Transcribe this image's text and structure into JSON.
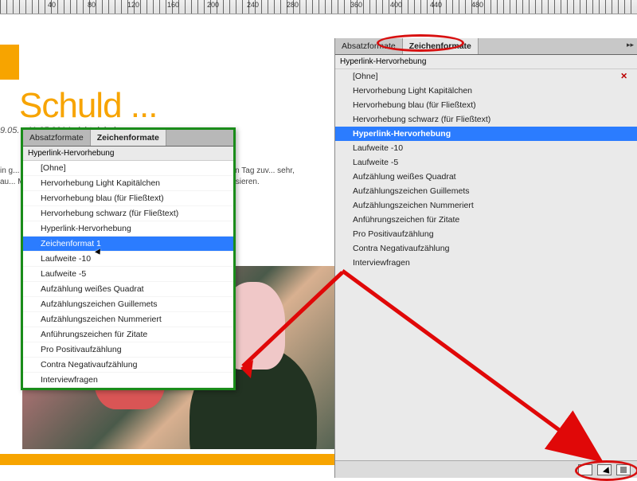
{
  "ruler": {
    "labels": [
      {
        "pos": 60,
        "text": "40"
      },
      {
        "pos": 110,
        "text": "80"
      },
      {
        "pos": 160,
        "text": "120"
      },
      {
        "pos": 210,
        "text": "160"
      },
      {
        "pos": 260,
        "text": "200"
      },
      {
        "pos": 310,
        "text": "240"
      },
      {
        "pos": 360,
        "text": "280"
      },
      {
        "pos": 440,
        "text": "360"
      },
      {
        "pos": 490,
        "text": "400"
      },
      {
        "pos": 540,
        "text": "440"
      },
      {
        "pos": 592,
        "text": "480"
      }
    ]
  },
  "document": {
    "title": "Schuld ...",
    "subtitle": "9.05. - 11.05.2014 nicht dabei war.",
    "body": "in g... n Be... ei. W... sehe... gest... on au... Mitglieder ersönlichen blieben: Ge- as Usertref- m nächsten  Tag zuv... sehr, d... tionster... hat, au... sieren."
  },
  "panels": {
    "tabs": {
      "absatz": "Absatzformate",
      "zeichen": "Zeichenformate"
    },
    "header": "Hyperlink-Hervorhebung",
    "none_label": "[Ohne]",
    "floating_items": [
      {
        "label": "[Ohne]"
      },
      {
        "label": "Hervorhebung Light Kapitälchen"
      },
      {
        "label": "Hervorhebung blau (für Fließtext)"
      },
      {
        "label": "Hervorhebung schwarz (für Fließtext)"
      },
      {
        "label": "Hyperlink-Hervorhebung"
      },
      {
        "label": "Zeichenformat 1",
        "selected": true
      },
      {
        "label": "Laufweite -10"
      },
      {
        "label": "Laufweite -5"
      },
      {
        "label": "Aufzählung weißes Quadrat"
      },
      {
        "label": "Aufzählungszeichen Guillemets"
      },
      {
        "label": "Aufzählungszeichen Nummeriert"
      },
      {
        "label": "Anführungszeichen für Zitate"
      },
      {
        "label": "Pro Positivaufzählung"
      },
      {
        "label": "Contra Negativaufzählung"
      },
      {
        "label": "Interviewfragen"
      }
    ],
    "docked_items": [
      {
        "label": "[Ohne]",
        "none": true
      },
      {
        "label": "Hervorhebung Light Kapitälchen"
      },
      {
        "label": "Hervorhebung blau (für Fließtext)"
      },
      {
        "label": "Hervorhebung schwarz (für Fließtext)"
      },
      {
        "label": "Hyperlink-Hervorhebung",
        "selected": true
      },
      {
        "label": "Laufweite -10"
      },
      {
        "label": "Laufweite -5"
      },
      {
        "label": "Aufzählung weißes Quadrat"
      },
      {
        "label": "Aufzählungszeichen Guillemets"
      },
      {
        "label": "Aufzählungszeichen Nummeriert"
      },
      {
        "label": "Anführungszeichen für Zitate"
      },
      {
        "label": "Pro Positivaufzählung"
      },
      {
        "label": "Contra Negativaufzählung"
      },
      {
        "label": "Interviewfragen"
      }
    ]
  }
}
